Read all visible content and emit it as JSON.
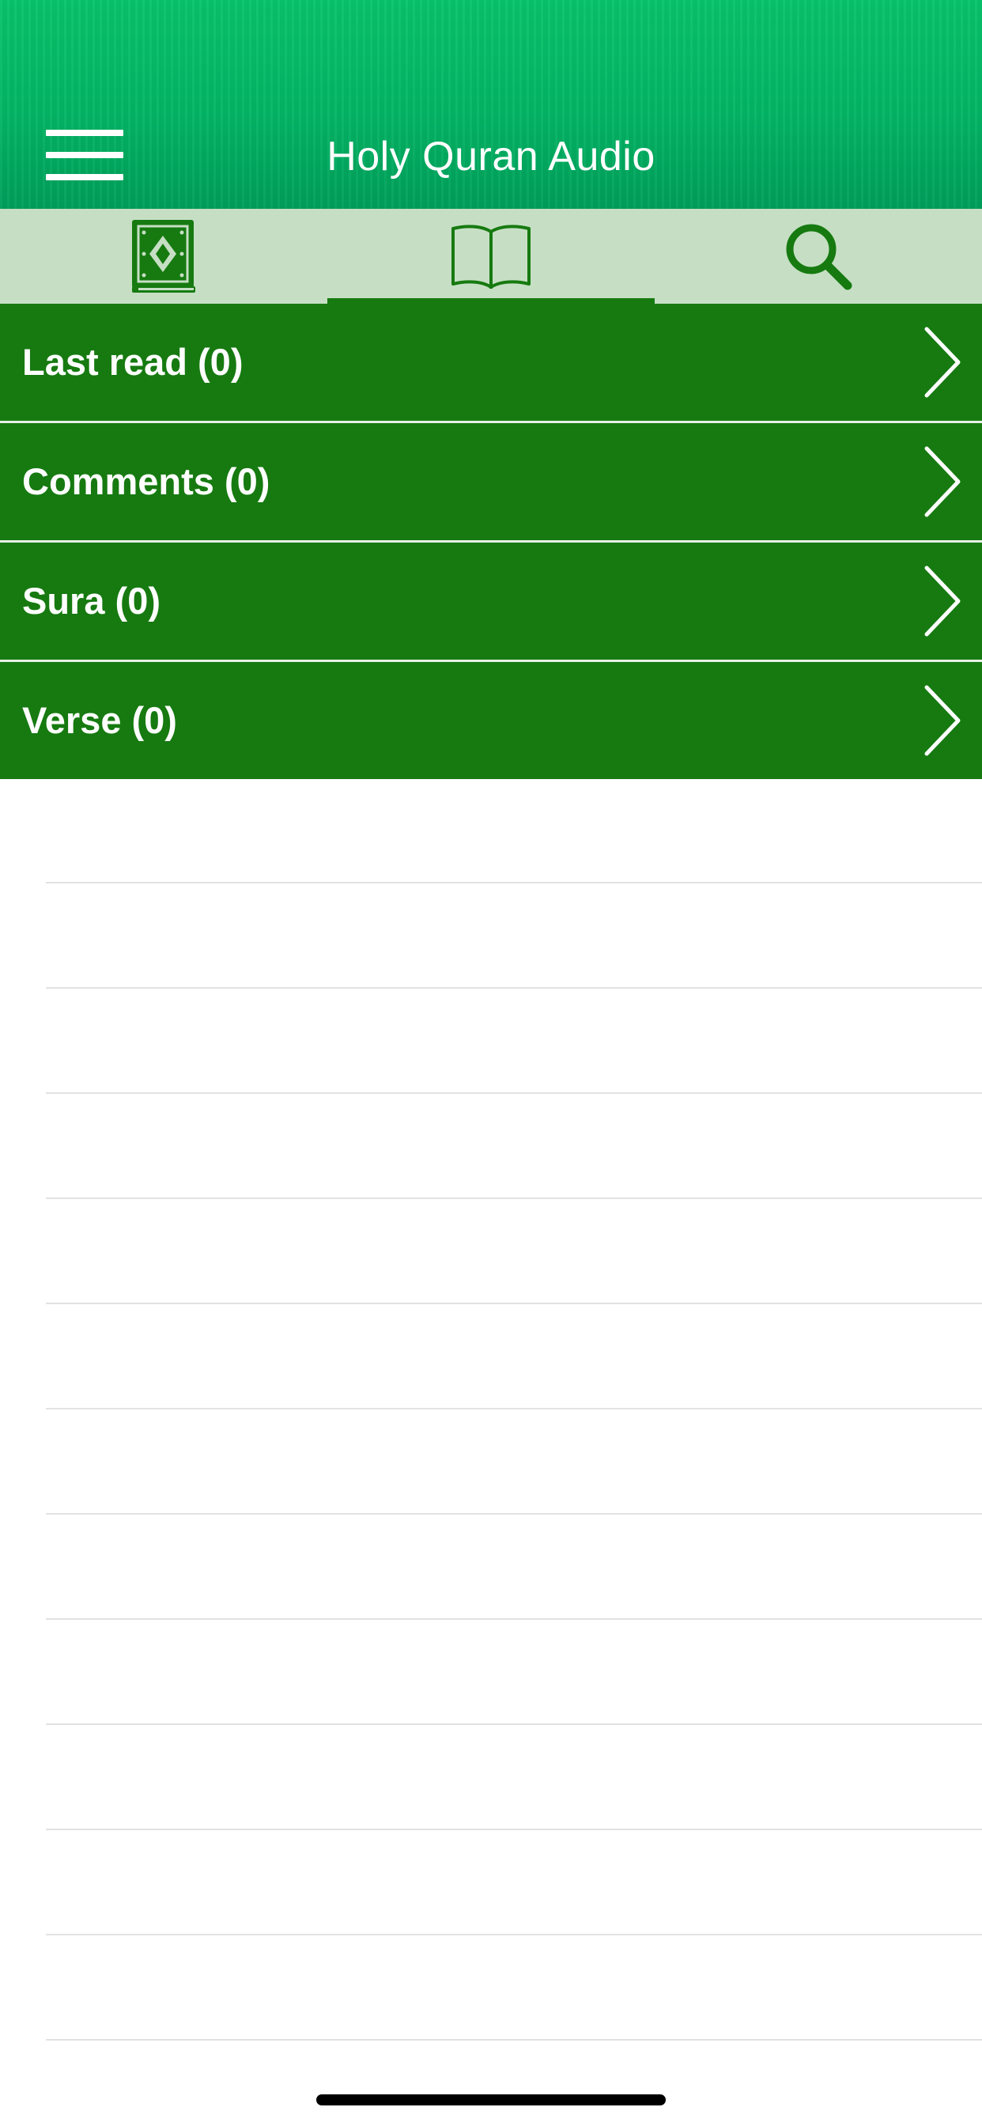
{
  "header": {
    "title": "Holy Quran Audio",
    "menu_icon": "hamburger-menu-icon",
    "gradient_top": "#08c46a",
    "gradient_bottom": "#009f5a"
  },
  "tabs": [
    {
      "name": "quran-book",
      "icon": "quran-book-icon",
      "active": false
    },
    {
      "name": "open-book",
      "icon": "open-book-icon",
      "active": true
    },
    {
      "name": "search",
      "icon": "search-icon",
      "active": false
    }
  ],
  "rows": [
    {
      "label": "Last read (0)"
    },
    {
      "label": "Comments (0)"
    },
    {
      "label": "Sura (0)"
    },
    {
      "label": "Verse (0)"
    }
  ],
  "colors": {
    "accent": "#167a10",
    "tabbar_bg": "#c6dfc4",
    "row_text": "#ffffff"
  }
}
